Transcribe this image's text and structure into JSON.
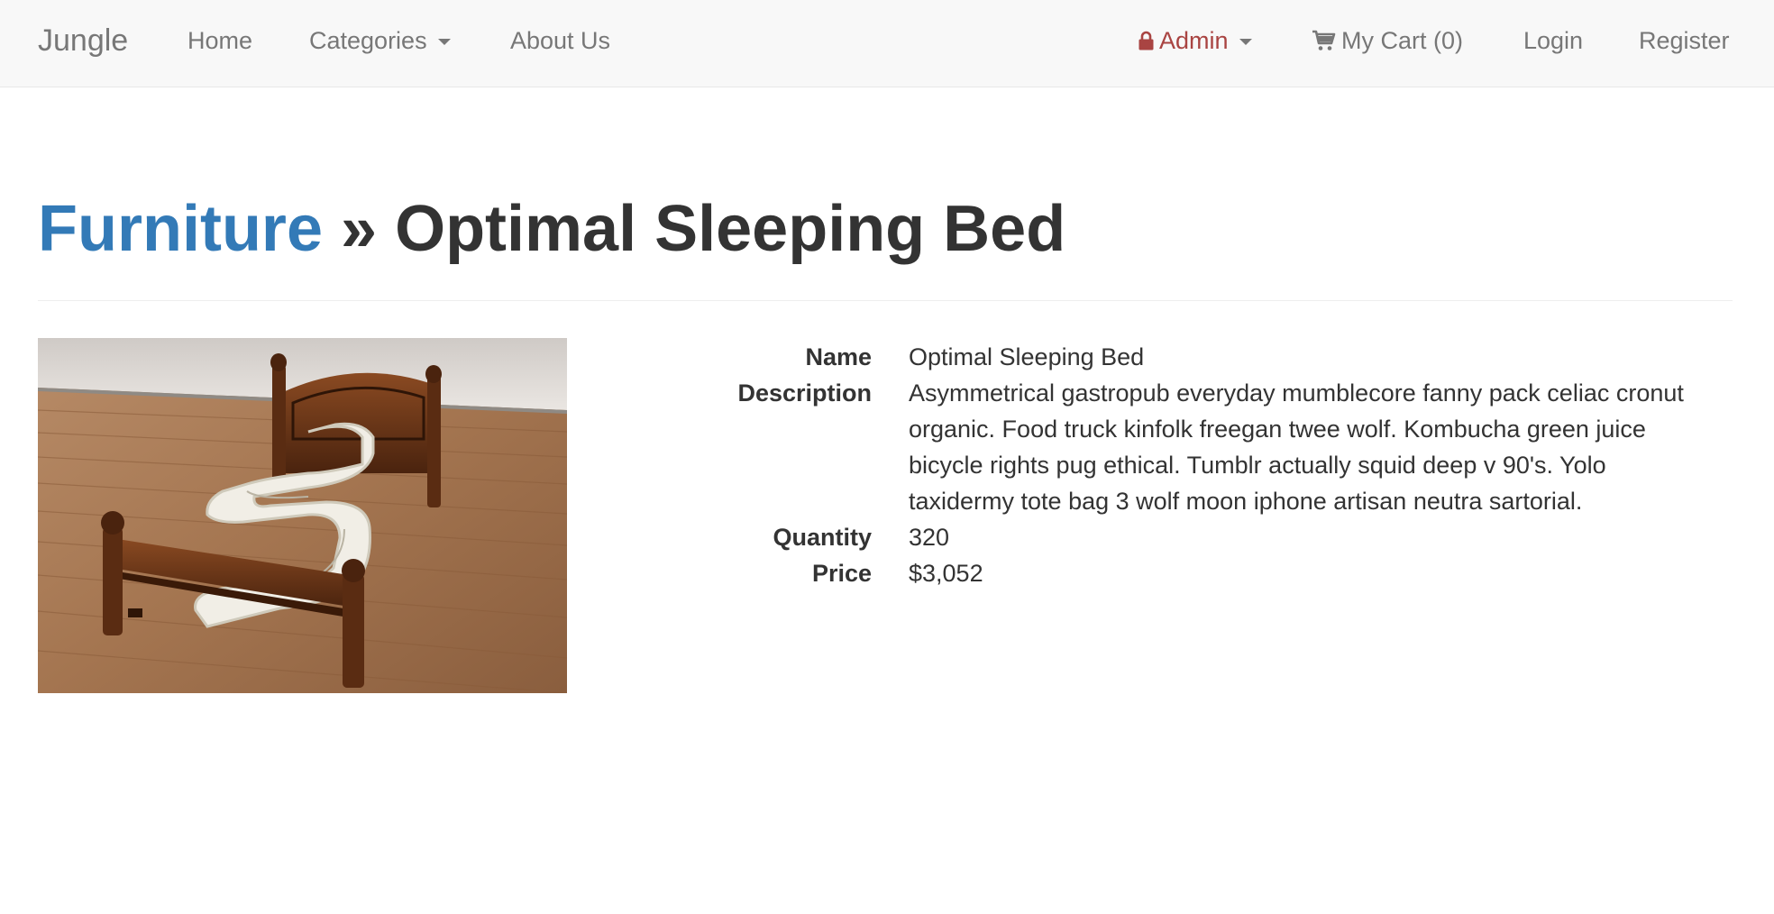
{
  "navbar": {
    "brand": "Jungle",
    "links": {
      "home": "Home",
      "categories": "Categories",
      "about": "About Us"
    },
    "admin": "Admin",
    "cart": "My Cart (0)",
    "login": "Login",
    "register": "Register"
  },
  "header": {
    "category": "Furniture",
    "separator": "»",
    "product_name": "Optimal Sleeping Bed"
  },
  "product": {
    "image_subject": "wooden bed frame with zigzag-shaped white mattress on a hardwood floor",
    "fields": [
      {
        "label": "Name",
        "value": "Optimal Sleeping Bed"
      },
      {
        "label": "Description",
        "value": "Asymmetrical gastropub everyday mumblecore fanny pack celiac cronut organic. Food truck kinfolk freegan twee wolf. Kombucha green juice bicycle rights pug ethical. Tumblr actually squid deep v 90's. Yolo taxidermy tote bag 3 wolf moon iphone artisan neutra sartorial."
      },
      {
        "label": "Quantity",
        "value": "320"
      },
      {
        "label": "Price",
        "value": "$3,052"
      }
    ]
  },
  "colors": {
    "link": "#337ab7",
    "admin": "#a94442",
    "navbar_bg": "#f8f8f8",
    "nav_text": "#777777",
    "text": "#333333"
  }
}
